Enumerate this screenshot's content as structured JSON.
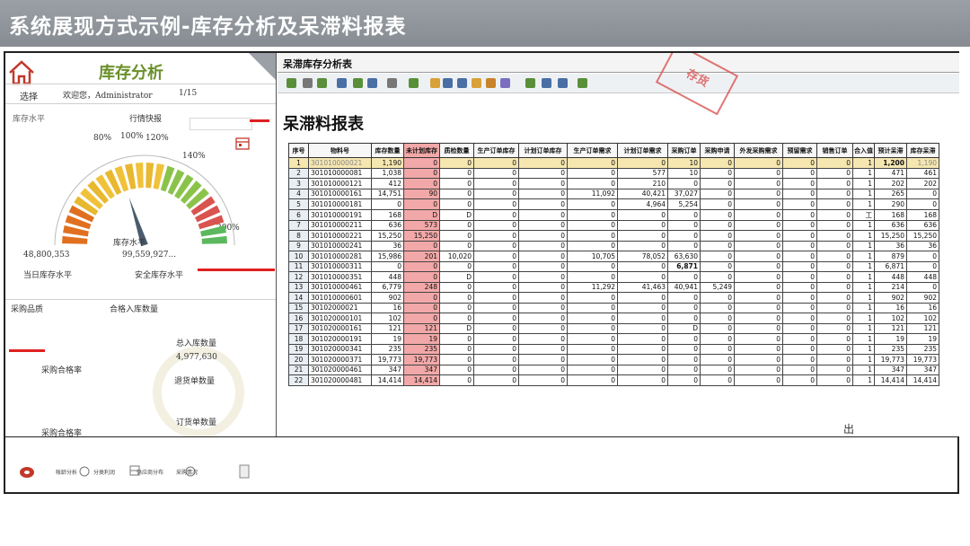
{
  "banner": {
    "title": "系统展现方式示例-库存分析及呆滞料报表"
  },
  "left_panel": {
    "title": "库存分析",
    "select_label": "选择",
    "welcome": "欢迎您，Administrator",
    "page": "1/15",
    "inventory_level_label": "库存水平",
    "quick_report_label": "行情快报",
    "gauge": {
      "ticks": [
        "80%",
        "100%",
        "120%",
        "140%",
        "200%"
      ],
      "center_label": "库存水平",
      "needle_fraction": 0.4
    },
    "value_today": "48,800,353",
    "value_safe": "99,559,927...",
    "today_label": "当日库存水平",
    "safe_label": "安全库存水平",
    "purchase_quality_label": "采购品质",
    "qualified_in_label": "合格入库数量",
    "total_in_label": "总入库数量",
    "total_in_value": "4,977,630",
    "pass_rate_label": "采购合格率",
    "return_label": "退货单数量",
    "order_label": "订货单数量",
    "order_value": "-",
    "pass_rate_label2": "采购合格率",
    "toolbar": [
      "帐龄分析",
      "分类利润",
      "供应商分布",
      "采购情况"
    ]
  },
  "report": {
    "window_title": "呆滞库存分析表",
    "stamp_text": "存货",
    "title": "呆滞料报表",
    "headers": [
      "序号",
      "物料号",
      "库存数量",
      "未计划库存",
      "质检数量",
      "生产订单库存",
      "计划订单库存",
      "生产订单需求",
      "计划订单需求",
      "采购订单",
      "采购申请",
      "外发采购需求",
      "预留需求",
      "销售订单",
      "合入值",
      "预计呆滞",
      "库存呆滞"
    ],
    "rows": [
      [
        "1",
        "301010000021",
        "1,190",
        "0",
        "0",
        "0",
        "0",
        "0",
        "0",
        "10",
        "0",
        "0",
        "0",
        "0",
        "1",
        "1,200",
        "1,190"
      ],
      [
        "2",
        "301010000081",
        "1,038",
        "0",
        "0",
        "0",
        "0",
        "0",
        "577",
        "10",
        "0",
        "0",
        "0",
        "0",
        "1",
        "471",
        "461"
      ],
      [
        "3",
        "301010000121",
        "412",
        "0",
        "0",
        "0",
        "0",
        "0",
        "210",
        "0",
        "0",
        "0",
        "0",
        "0",
        "1",
        "202",
        "202"
      ],
      [
        "4",
        "301010000161",
        "14,751",
        "90",
        "0",
        "0",
        "0",
        "11,092",
        "40,421",
        "37,027",
        "0",
        "0",
        "0",
        "0",
        "1",
        "265",
        "0"
      ],
      [
        "5",
        "301010000181",
        "0",
        "0",
        "0",
        "0",
        "0",
        "0",
        "4,964",
        "5,254",
        "0",
        "0",
        "0",
        "0",
        "1",
        "290",
        "0"
      ],
      [
        "6",
        "301010000191",
        "168",
        "D",
        "D",
        "0",
        "0",
        "0",
        "0",
        "0",
        "0",
        "0",
        "0",
        "0",
        "工",
        "168",
        "168"
      ],
      [
        "7",
        "301010000211",
        "636",
        "573",
        "0",
        "0",
        "0",
        "0",
        "0",
        "0",
        "0",
        "0",
        "0",
        "0",
        "1",
        "636",
        "636"
      ],
      [
        "8",
        "301010000221",
        "15,250",
        "15,250",
        "0",
        "0",
        "0",
        "0",
        "0",
        "0",
        "0",
        "0",
        "0",
        "0",
        "1",
        "15,250",
        "15,250"
      ],
      [
        "9",
        "301010000241",
        "36",
        "0",
        "0",
        "0",
        "0",
        "0",
        "0",
        "0",
        "0",
        "0",
        "0",
        "0",
        "1",
        "36",
        "36"
      ],
      [
        "10",
        "301010000281",
        "15,986",
        "201",
        "10,020",
        "0",
        "0",
        "10,705",
        "78,052",
        "63,630",
        "0",
        "0",
        "0",
        "0",
        "1",
        "879",
        "0"
      ],
      [
        "11",
        "301010000311",
        "0",
        "0",
        "0",
        "0",
        "0",
        "0",
        "0",
        "6,871",
        "0",
        "0",
        "0",
        "0",
        "1",
        "6,871",
        "0"
      ],
      [
        "12",
        "301010000351",
        "448",
        "0",
        "D",
        "0",
        "0",
        "0",
        "0",
        "0",
        "0",
        "0",
        "0",
        "0",
        "1",
        "448",
        "448"
      ],
      [
        "13",
        "301010000461",
        "6,779",
        "248",
        "0",
        "0",
        "0",
        "11,292",
        "41,463",
        "40,941",
        "5,249",
        "0",
        "0",
        "0",
        "1",
        "214",
        "0"
      ],
      [
        "14",
        "301010000601",
        "902",
        "0",
        "0",
        "0",
        "0",
        "0",
        "0",
        "0",
        "0",
        "0",
        "0",
        "0",
        "1",
        "902",
        "902"
      ],
      [
        "15",
        "30102000021",
        "16",
        "0",
        "0",
        "0",
        "0",
        "0",
        "0",
        "0",
        "0",
        "0",
        "0",
        "0",
        "1",
        "16",
        "16"
      ],
      [
        "16",
        "301020000101",
        "102",
        "0",
        "0",
        "0",
        "0",
        "0",
        "0",
        "0",
        "0",
        "0",
        "0",
        "0",
        "1",
        "102",
        "102"
      ],
      [
        "17",
        "301020000161",
        "121",
        "121",
        "D",
        "0",
        "0",
        "0",
        "0",
        "D",
        "0",
        "0",
        "0",
        "0",
        "1",
        "121",
        "121"
      ],
      [
        "18",
        "301020000191",
        "19",
        "19",
        "0",
        "0",
        "0",
        "0",
        "0",
        "0",
        "0",
        "0",
        "0",
        "0",
        "1",
        "19",
        "19"
      ],
      [
        "19",
        "301020000341",
        "235",
        "235",
        "0",
        "0",
        "0",
        "0",
        "0",
        "0",
        "0",
        "0",
        "0",
        "0",
        "1",
        "235",
        "235"
      ],
      [
        "20",
        "301020000371",
        "19,773",
        "19,773",
        "0",
        "0",
        "0",
        "0",
        "0",
        "0",
        "0",
        "0",
        "0",
        "0",
        "1",
        "19,773",
        "19,773"
      ],
      [
        "21",
        "301020000461",
        "347",
        "347",
        "0",
        "0",
        "0",
        "0",
        "0",
        "0",
        "0",
        "0",
        "0",
        "0",
        "1",
        "347",
        "347"
      ],
      [
        "22",
        "301020000481",
        "14,414",
        "14,414",
        "0",
        "0",
        "0",
        "0",
        "0",
        "0",
        "0",
        "0",
        "0",
        "0",
        "1",
        "14,414",
        "14,414"
      ]
    ],
    "bottom_glyph": "出"
  }
}
